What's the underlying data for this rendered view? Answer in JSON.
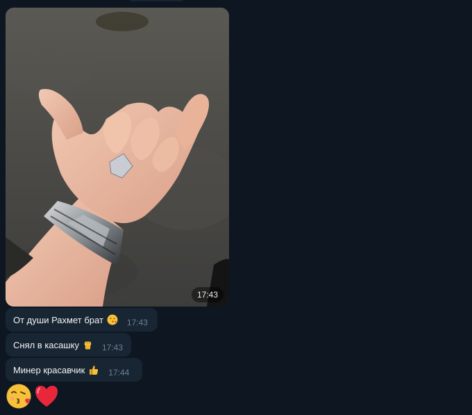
{
  "chat": {
    "photo": {
      "time": "17:43",
      "description_icon": "photo-hand-with-watch"
    },
    "messages": [
      {
        "text": "От души Рахмет брат",
        "emoji": "kissing-face-icon",
        "time": "17:43"
      },
      {
        "text": "Снял в касашку",
        "emoji": "raised-fist-icon",
        "time": "17:43"
      },
      {
        "text": "Минер красавчик",
        "emoji": "thumbs-up-icon",
        "time": "17:44"
      }
    ],
    "big_emojis": [
      "face-blowing-kiss-icon",
      "red-heart-icon"
    ]
  },
  "colors": {
    "background": "#0e1621",
    "bubble": "#182533",
    "text": "#f5f5f5",
    "time": "#6d8096"
  }
}
